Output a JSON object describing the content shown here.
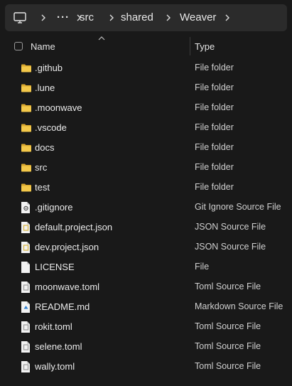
{
  "addressbar": {
    "computer_icon": "computer-icon",
    "overflow": "···",
    "crumbs": [
      "src",
      "shared",
      "Weaver"
    ]
  },
  "header": {
    "name": "Name",
    "type": "Type"
  },
  "files": [
    {
      "name": ".github",
      "type": "File folder",
      "icon": "folder-icon"
    },
    {
      "name": ".lune",
      "type": "File folder",
      "icon": "folder-icon"
    },
    {
      "name": ".moonwave",
      "type": "File folder",
      "icon": "folder-icon"
    },
    {
      "name": ".vscode",
      "type": "File folder",
      "icon": "folder-icon"
    },
    {
      "name": "docs",
      "type": "File folder",
      "icon": "folder-icon"
    },
    {
      "name": "src",
      "type": "File folder",
      "icon": "folder-icon"
    },
    {
      "name": "test",
      "type": "File folder",
      "icon": "folder-icon"
    },
    {
      "name": ".gitignore",
      "type": "Git Ignore Source File",
      "icon": "gitignore-file-icon"
    },
    {
      "name": "default.project.json",
      "type": "JSON Source File",
      "icon": "json-file-icon"
    },
    {
      "name": "dev.project.json",
      "type": "JSON Source File",
      "icon": "json-file-icon"
    },
    {
      "name": "LICENSE",
      "type": "File",
      "icon": "blank-file-icon"
    },
    {
      "name": "moonwave.toml",
      "type": "Toml Source File",
      "icon": "toml-file-icon"
    },
    {
      "name": "README.md",
      "type": "Markdown Source File",
      "icon": "markdown-file-icon"
    },
    {
      "name": "rokit.toml",
      "type": "Toml Source File",
      "icon": "toml-file-icon"
    },
    {
      "name": "selene.toml",
      "type": "Toml Source File",
      "icon": "toml-file-icon"
    },
    {
      "name": "wally.toml",
      "type": "Toml Source File",
      "icon": "toml-file-icon"
    }
  ],
  "colors": {
    "folder": "#f3c84a",
    "folder_dark": "#d9a82e",
    "file_page": "#f2f2f2",
    "json_accent": "#d6b23c",
    "toml_accent": "#9a9a9a",
    "markdown_accent": "#2f7fd1"
  }
}
